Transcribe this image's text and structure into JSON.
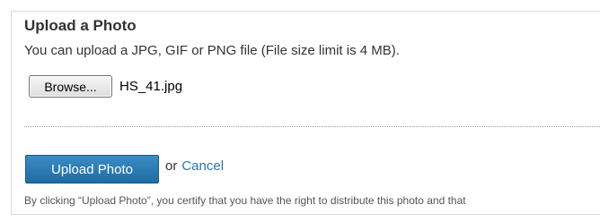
{
  "upload": {
    "title": "Upload a Photo",
    "description": "You can upload a JPG, GIF or PNG file (File size limit is 4 MB).",
    "browse_label": "Browse...",
    "file_name": "HS_41.jpg",
    "submit_label": "Upload Photo",
    "or_text": "or",
    "cancel_label": "Cancel",
    "disclaimer": "By clicking “Upload Photo”, you certify that you have the right to distribute this photo and that"
  },
  "colors": {
    "primary_button": "#2a7ab8",
    "link": "#2a76b5"
  }
}
